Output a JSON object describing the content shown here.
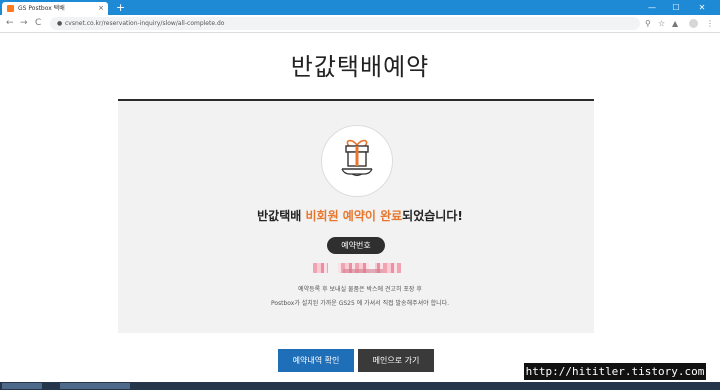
{
  "browser": {
    "tab_title": "GS Postbox 택배",
    "tab_close": "×",
    "new_tab": "+",
    "url": "cvsnet.co.kr/reservation-inquiry/slow/all-complete.do",
    "window_controls": [
      "—",
      "☐",
      "✕"
    ],
    "nav": [
      "←",
      "→",
      "C"
    ],
    "lock_glyph": "🔒"
  },
  "page": {
    "title": "반값택배예약",
    "headline_pre": "반값택배 ",
    "headline_accent": "비회원 예약이 완료",
    "headline_post": "되었습니다!",
    "reservation_pill": "예약번호",
    "info_line_1": "예약등록 후 보내실 물품은 박스에 견고히 포장 후",
    "info_line_2": "Postbox가 설치된 가까운 GS25 에 가셔서 직접 발송해주셔야 합니다.",
    "buttons": {
      "confirm": "예약내역 확인",
      "main": "메인으로 가기"
    },
    "watermark": "http://hititler.tistory.com"
  },
  "colors": {
    "accent": "#e8772e",
    "confirm_button": "#1f6fb8",
    "main_button": "#3a3a3a",
    "tabbar": "#1e8ad6"
  },
  "icons": {
    "gift": "gift-box-on-tray-icon",
    "lock": "lock-icon",
    "key": "key-icon",
    "star": "star-icon",
    "extension": "extension-icon",
    "menu": "more-vert-icon"
  }
}
